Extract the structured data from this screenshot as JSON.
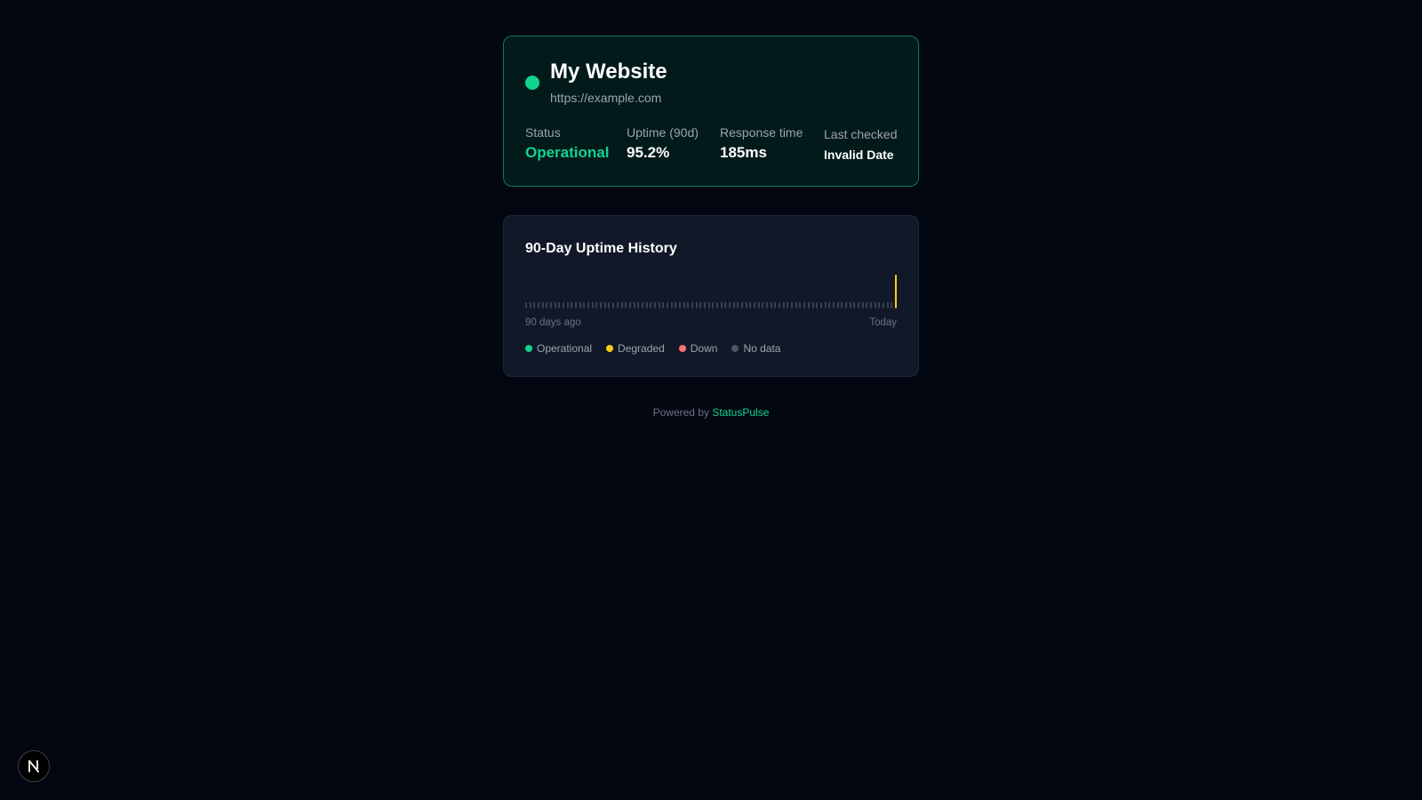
{
  "site": {
    "name": "My Website",
    "url": "https://example.com",
    "status_color": "#10d48e"
  },
  "stats": {
    "status": {
      "label": "Status",
      "value": "Operational"
    },
    "uptime": {
      "label": "Uptime (90d)",
      "value": "95.2%"
    },
    "response": {
      "label": "Response time",
      "value": "185ms"
    },
    "last_checked": {
      "label": "Last checked",
      "value": "Invalid Date"
    }
  },
  "history": {
    "title": "90-Day Uptime History",
    "start_label": "90 days ago",
    "end_label": "Today",
    "days": 90,
    "daily_status": [
      "no-data",
      "no-data",
      "no-data",
      "no-data",
      "no-data",
      "no-data",
      "no-data",
      "no-data",
      "no-data",
      "no-data",
      "no-data",
      "no-data",
      "no-data",
      "no-data",
      "no-data",
      "no-data",
      "no-data",
      "no-data",
      "no-data",
      "no-data",
      "no-data",
      "no-data",
      "no-data",
      "no-data",
      "no-data",
      "no-data",
      "no-data",
      "no-data",
      "no-data",
      "no-data",
      "no-data",
      "no-data",
      "no-data",
      "no-data",
      "no-data",
      "no-data",
      "no-data",
      "no-data",
      "no-data",
      "no-data",
      "no-data",
      "no-data",
      "no-data",
      "no-data",
      "no-data",
      "no-data",
      "no-data",
      "no-data",
      "no-data",
      "no-data",
      "no-data",
      "no-data",
      "no-data",
      "no-data",
      "no-data",
      "no-data",
      "no-data",
      "no-data",
      "no-data",
      "no-data",
      "no-data",
      "no-data",
      "no-data",
      "no-data",
      "no-data",
      "no-data",
      "no-data",
      "no-data",
      "no-data",
      "no-data",
      "no-data",
      "no-data",
      "no-data",
      "no-data",
      "no-data",
      "no-data",
      "no-data",
      "no-data",
      "no-data",
      "no-data",
      "no-data",
      "no-data",
      "no-data",
      "no-data",
      "no-data",
      "no-data",
      "no-data",
      "no-data",
      "no-data",
      "degraded"
    ],
    "legend": [
      {
        "label": "Operational",
        "color": "#10d48e"
      },
      {
        "label": "Degraded",
        "color": "#facc15"
      },
      {
        "label": "Down",
        "color": "#f87171"
      },
      {
        "label": "No data",
        "color": "#4b5563"
      }
    ]
  },
  "footer": {
    "prefix": "Powered by",
    "brand": "StatusPulse"
  },
  "badge": {
    "letter": "N"
  }
}
